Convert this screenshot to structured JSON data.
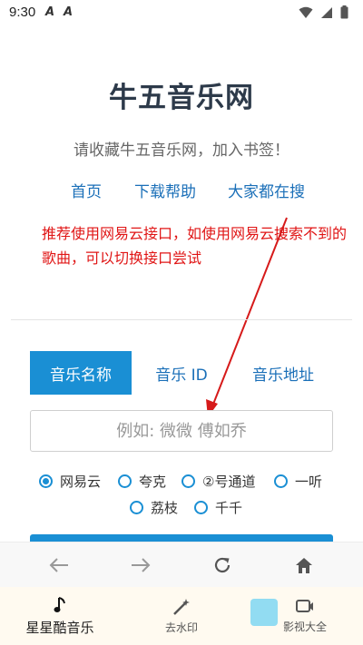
{
  "status": {
    "time": "9:30",
    "left_icons": [
      "A",
      "A"
    ],
    "right_icons": [
      "wifi-icon",
      "signal-icon",
      "battery-icon"
    ]
  },
  "header": {
    "title": "牛五音乐网",
    "subtitle": "请收藏牛五音乐网，加入书签！"
  },
  "nav": [
    {
      "label": "首页"
    },
    {
      "label": "下载帮助"
    },
    {
      "label": "大家都在搜"
    }
  ],
  "note": "推荐使用网易云接口，如使用网易云搜索不到的歌曲，可以切换接口尝试",
  "tabs": [
    {
      "label": "音乐名称",
      "active": true
    },
    {
      "label": "音乐 ID",
      "active": false
    },
    {
      "label": "音乐地址",
      "active": false
    }
  ],
  "search": {
    "placeholder": "例如: 微微 傅如乔"
  },
  "sources": [
    {
      "label": "网易云",
      "checked": true
    },
    {
      "label": "夸克",
      "checked": false
    },
    {
      "label": "②号通道",
      "checked": false
    },
    {
      "label": "一听",
      "checked": false
    },
    {
      "label": "荔枝",
      "checked": false
    },
    {
      "label": "千千",
      "checked": false
    }
  ],
  "bottom_nav": [
    {
      "label": "星星酷音乐",
      "icon": "music-note-icon",
      "active": true
    },
    {
      "label": "去水印",
      "icon": "magic-wand-icon",
      "active": false
    },
    {
      "label": "影视大全",
      "icon": "video-icon",
      "active": false
    }
  ],
  "colors": {
    "accent": "#1a8fd4",
    "link": "#1a6fb8",
    "note": "#e01515",
    "title": "#2d3a4a"
  }
}
